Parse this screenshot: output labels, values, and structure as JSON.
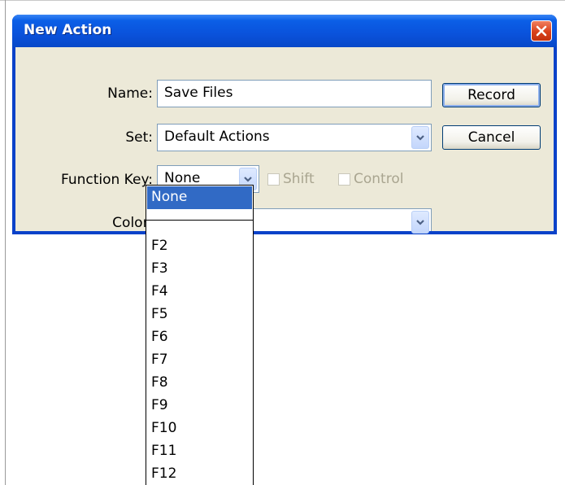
{
  "window": {
    "title": "New Action"
  },
  "form": {
    "name_label": "Name:",
    "name_value": "Save Files",
    "set_label": "Set:",
    "set_value": "Default Actions",
    "function_key_label": "Function Key:",
    "function_key_value": "None",
    "shift_label": "Shift",
    "control_label": "Control",
    "color_label": "Color:",
    "color_value": ""
  },
  "buttons": {
    "record": "Record",
    "cancel": "Cancel"
  },
  "dropdown": {
    "selected": "None",
    "options": [
      "F2",
      "F3",
      "F4",
      "F5",
      "F6",
      "F7",
      "F8",
      "F9",
      "F10",
      "F11",
      "F12"
    ]
  },
  "icons": {
    "close": "close-icon",
    "dropdown": "chevron-down-icon"
  },
  "colors": {
    "title_bar": "#0a52db",
    "close_button": "#d9411b",
    "selection": "#316ac5",
    "dialog_bg": "#ece9d8"
  }
}
